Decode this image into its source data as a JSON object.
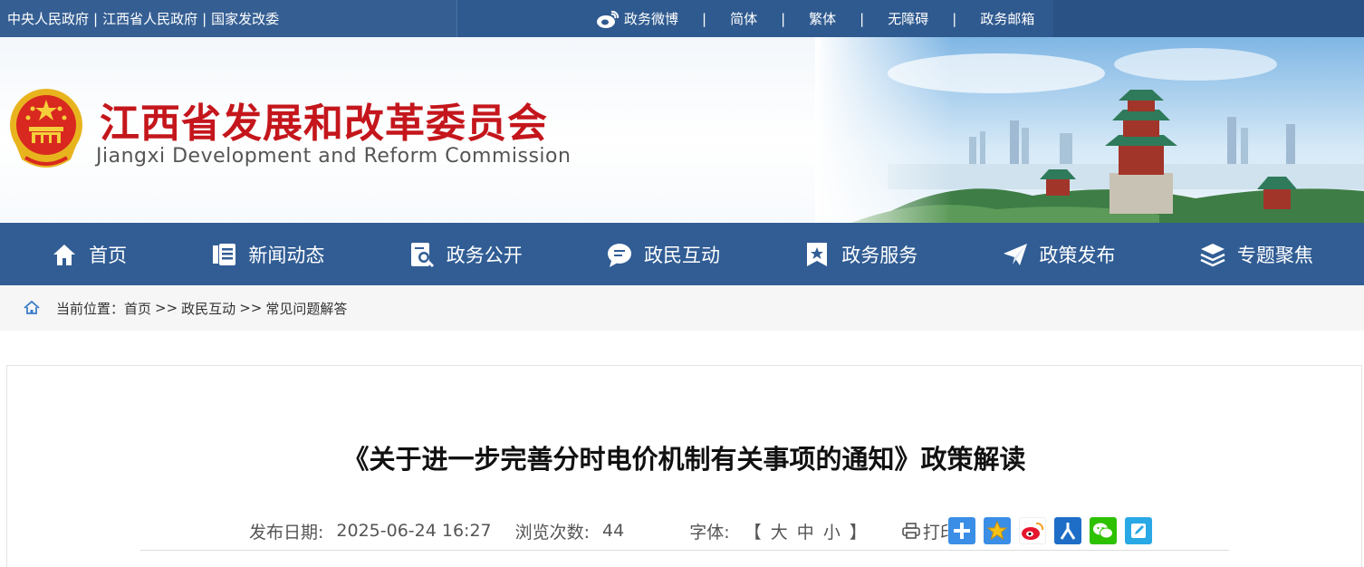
{
  "topbar": {
    "links": [
      "中央人民政府",
      "江西省人民政府",
      "国家发改委"
    ],
    "separator": "|",
    "right_items": [
      "政务微博",
      "简体",
      "繁体",
      "无障碍",
      "政务邮箱"
    ],
    "right_separator": "|"
  },
  "banner": {
    "title": "江西省发展和改革委员会",
    "subtitle": "Jiangxi Development and Reform Commission"
  },
  "nav": {
    "items": [
      {
        "label": "首页",
        "icon": "home-icon"
      },
      {
        "label": "新闻动态",
        "icon": "news-icon"
      },
      {
        "label": "政务公开",
        "icon": "document-search-icon"
      },
      {
        "label": "政民互动",
        "icon": "chat-icon"
      },
      {
        "label": "政务服务",
        "icon": "star-bookmark-icon"
      },
      {
        "label": "政策发布",
        "icon": "paper-plane-icon"
      },
      {
        "label": "专题聚焦",
        "icon": "layers-icon"
      }
    ]
  },
  "breadcrumb": {
    "prefix": "当前位置：",
    "items": [
      "首页",
      "政民互动",
      "常见问题解答"
    ],
    "separator": ">>"
  },
  "article": {
    "title": "《关于进一步完善分时电价机制有关事项的通知》政策解读",
    "date_label": "发布日期:",
    "date_value": "2025-06-24 16:27",
    "views_label": "浏览次数:",
    "views_value": "44",
    "font_label": "字体:",
    "bracket_open": "【",
    "bracket_close": "】",
    "font_sizes": [
      "大",
      "中",
      "小"
    ],
    "print_label": "打印"
  },
  "share": {
    "icons": [
      "share-plus-icon",
      "favorite-star-icon",
      "weibo-icon",
      "renren-icon",
      "wechat-icon",
      "edit-note-icon"
    ]
  },
  "colors": {
    "brand_blue": "#315d94",
    "title_red": "#c4161c"
  }
}
